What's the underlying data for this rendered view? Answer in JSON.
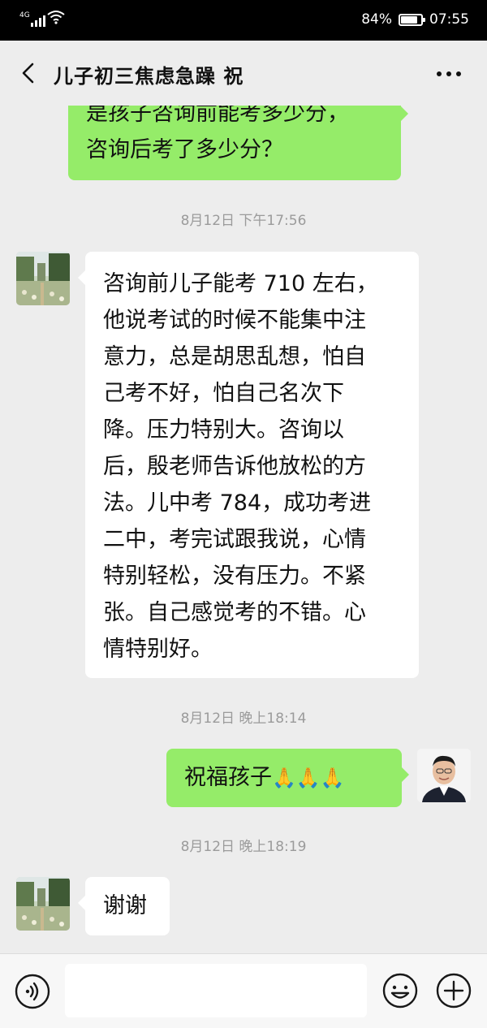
{
  "status_bar": {
    "network": "4G",
    "battery": "84%",
    "battery_level": 0.84,
    "time": "07:55"
  },
  "nav": {
    "title": "儿子初三焦虑急躁  祝",
    "back_icon": "chevron-left-icon",
    "more_icon": "more-horizontal-icon"
  },
  "messages": [
    {
      "side": "right",
      "lines": [
        "是孩子咨询前能考多少分，",
        "咨询后考了多少分？"
      ]
    },
    {
      "timestamp": "8月12日 下午17:56"
    },
    {
      "side": "left",
      "lines": [
        "咨询前儿子能考 710 左右，",
        "他说考试的时候不能集中注",
        "意力，总是胡思乱想，怕自",
        "己考不好，怕自己名次下",
        "降。压力特别大。咨询以",
        "后，殷老师告诉他放松的方",
        "法。儿中考 784，成功考进",
        "二中，考完试跟我说，心情",
        "特别轻松，没有压力。不紧",
        "张。自己感觉考的不错。心",
        "情特别好。"
      ]
    },
    {
      "timestamp": "8月12日 晚上18:14"
    },
    {
      "side": "right",
      "text": "祝福孩子",
      "emoji": "🙏🙏🙏"
    },
    {
      "timestamp": "8月12日 晚上18:19"
    },
    {
      "side": "left",
      "text": "谢谢"
    }
  ],
  "input_bar": {
    "voice_icon": "voice-icon",
    "emoji_icon": "emoji-icon",
    "plus_icon": "plus-icon",
    "placeholder": ""
  },
  "colors": {
    "sent_bubble": "#95ec69",
    "received_bubble": "#ffffff",
    "chat_background": "#ededed"
  }
}
